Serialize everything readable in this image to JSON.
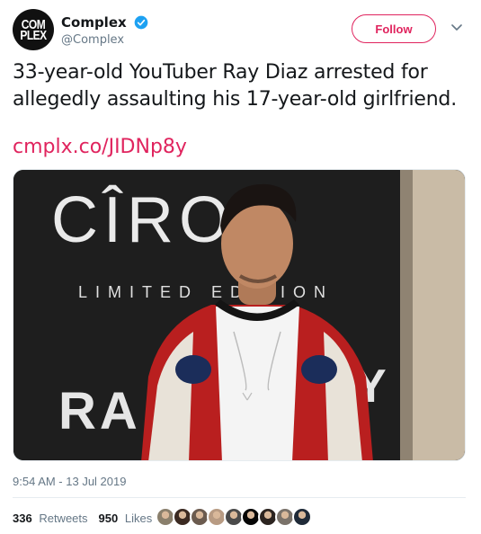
{
  "account": {
    "display_name": "Complex",
    "handle": "@Complex",
    "avatar_text_line1": "COM",
    "avatar_text_line2": "PLEX"
  },
  "actions": {
    "follow_label": "Follow"
  },
  "tweet": {
    "text": "33-year-old YouTuber Ray Diaz arrested for allegedly assaulting his 17-year-old girlfriend.",
    "link": "cmplx.co/JIDNp8y",
    "timestamp": "9:54 AM - 13 Jul 2019"
  },
  "media": {
    "backdrop_brand": "CÎROC",
    "backdrop_line2": "LIMITED EDITION",
    "backdrop_line3": "RA"
  },
  "stats": {
    "retweets_count": "336",
    "retweets_label": "Retweets",
    "likes_count": "950",
    "likes_label": "Likes"
  },
  "likers": [
    {
      "color": "#8a7f6c"
    },
    {
      "color": "#3b2a22"
    },
    {
      "color": "#6b5b4f"
    },
    {
      "color": "#b89b83"
    },
    {
      "color": "#4a4a4a"
    },
    {
      "color": "#050505"
    },
    {
      "color": "#2c2420"
    },
    {
      "color": "#7a726a"
    },
    {
      "color": "#1f2a38"
    }
  ],
  "colors": {
    "accent": "#e0245e",
    "verified": "#1da1f2",
    "muted": "#657786"
  }
}
